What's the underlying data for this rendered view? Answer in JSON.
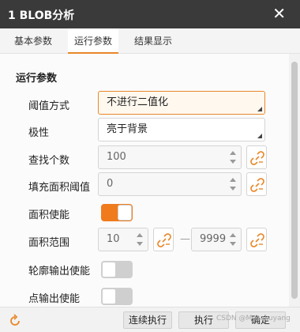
{
  "window": {
    "title": "1 BLOB分析",
    "close_glyph": "✕"
  },
  "tabs": [
    {
      "label": "基本参数",
      "active": false
    },
    {
      "label": "运行参数",
      "active": true
    },
    {
      "label": "结果显示",
      "active": false
    }
  ],
  "section": {
    "title": "运行参数"
  },
  "threshold_mode": {
    "label": "阈值方式",
    "value": "不进行二值化"
  },
  "polarity": {
    "label": "极性",
    "value": "亮于背景"
  },
  "find_count": {
    "label": "查找个数",
    "value": "100"
  },
  "fill_area_threshold": {
    "label": "填充面积阈值",
    "value": "0"
  },
  "area_enable": {
    "label": "面积使能",
    "on": true
  },
  "area_range": {
    "label": "面积范围",
    "min": "10",
    "separator": "—",
    "max": "9999"
  },
  "contour_output_enable": {
    "label": "轮廓输出使能",
    "on": false
  },
  "point_output_enable": {
    "label": "点输出使能",
    "on": false
  },
  "footer": {
    "continuous_run": "连续执行",
    "run": "执行",
    "confirm": "确定",
    "watermark": "CSDN @Mosakuyang"
  },
  "colors": {
    "accent": "#f07b1d",
    "titlebar": "#3a3a3a"
  },
  "icons": {
    "link": "link-icon",
    "close": "close-icon",
    "reset": "reset-icon"
  }
}
